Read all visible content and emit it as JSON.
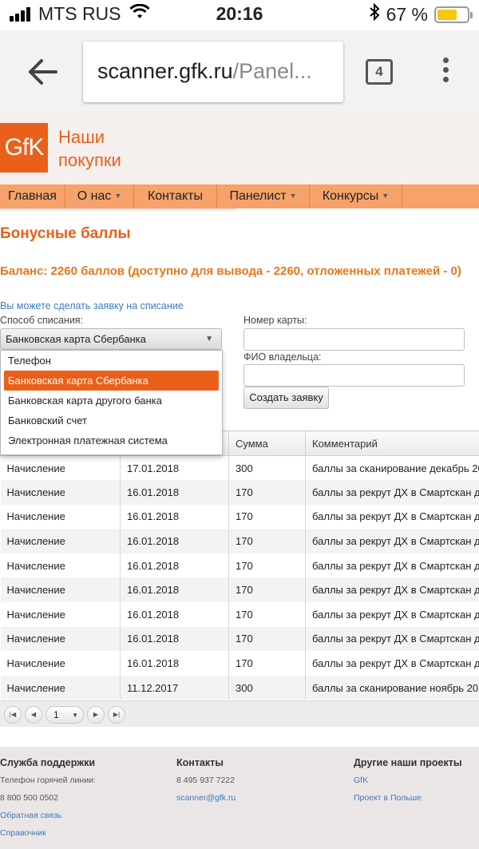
{
  "status_bar": {
    "carrier": "MTS RUS",
    "time": "20:16",
    "battery": "67 %",
    "battery_level": 0.67
  },
  "browser": {
    "url_host": "scanner.gfk.ru",
    "url_path": "/Panel...",
    "tab_count": "4"
  },
  "header": {
    "logo_text": "GfK",
    "title_line1": "Наши",
    "title_line2": "покупки"
  },
  "nav": {
    "items": [
      {
        "label": "Главная",
        "has_menu": false
      },
      {
        "label": "О нас",
        "has_menu": true
      },
      {
        "label": "Контакты",
        "has_menu": false
      },
      {
        "label": "Панелист",
        "has_menu": true
      },
      {
        "label": "Конкурсы",
        "has_menu": true
      }
    ]
  },
  "main": {
    "heading": "Бонусные баллы",
    "balance": "Баланс: 2260 баллов (доступно для вывода - 2260, отложенных платежей - 0)",
    "request_link": "Вы можете сделать заявку на списание",
    "method_label": "Способ списания:",
    "method_selected": "Банковская карта Сбербанка",
    "method_options": [
      "Телефон",
      "Банковская карта Сбербанка",
      "Банковская карта другого банка",
      "Банковский счет",
      "Электронная платежная система"
    ],
    "card_label": "Номер карты:",
    "owner_label": "ФИО владельца:",
    "submit_label": "Создать заявку"
  },
  "table": {
    "columns": [
      "",
      "",
      "Сумма",
      "Комментарий"
    ],
    "rows": [
      {
        "type": "Начисление",
        "date": "17.01.2018",
        "amount": "300",
        "comment": "баллы за сканирование декабрь 20"
      },
      {
        "type": "Начисление",
        "date": "16.01.2018",
        "amount": "170",
        "comment": "баллы за рекрут ДХ в Смартскан д"
      },
      {
        "type": "Начисление",
        "date": "16.01.2018",
        "amount": "170",
        "comment": "баллы за рекрут ДХ в Смартскан д"
      },
      {
        "type": "Начисление",
        "date": "16.01.2018",
        "amount": "170",
        "comment": "баллы за рекрут ДХ в Смартскан д"
      },
      {
        "type": "Начисление",
        "date": "16.01.2018",
        "amount": "170",
        "comment": "баллы за рекрут ДХ в Смартскан д"
      },
      {
        "type": "Начисление",
        "date": "16.01.2018",
        "amount": "170",
        "comment": "баллы за рекрут ДХ в Смартскан д"
      },
      {
        "type": "Начисление",
        "date": "16.01.2018",
        "amount": "170",
        "comment": "баллы за рекрут ДХ в Смартскан д"
      },
      {
        "type": "Начисление",
        "date": "16.01.2018",
        "amount": "170",
        "comment": "баллы за рекрут ДХ в Смартскан д"
      },
      {
        "type": "Начисление",
        "date": "16.01.2018",
        "amount": "170",
        "comment": "баллы за рекрут ДХ в Смартскан д"
      },
      {
        "type": "Начисление",
        "date": "11.12.2017",
        "amount": "300",
        "comment": "баллы за сканирование ноябрь 201"
      }
    ],
    "page": "1"
  },
  "footer": {
    "support": {
      "heading": "Служба поддержки",
      "hotline_label": "Телефон горячей линии:",
      "hotline": "8 800 500 0502",
      "feedback": "Обратная связь",
      "reference": "Справочник"
    },
    "contacts": {
      "heading": "Контакты",
      "phone": "8 495 937 7222",
      "email": "scanner@gfk.ru"
    },
    "projects": {
      "heading": "Другие наши проекты",
      "gfk": "GfK",
      "poland": "Проект в Польше"
    }
  },
  "colors": {
    "brand": "#e8601a",
    "nav_bg": "#f6a26a",
    "link": "#3a7bbf",
    "battery": "#f6c708"
  }
}
